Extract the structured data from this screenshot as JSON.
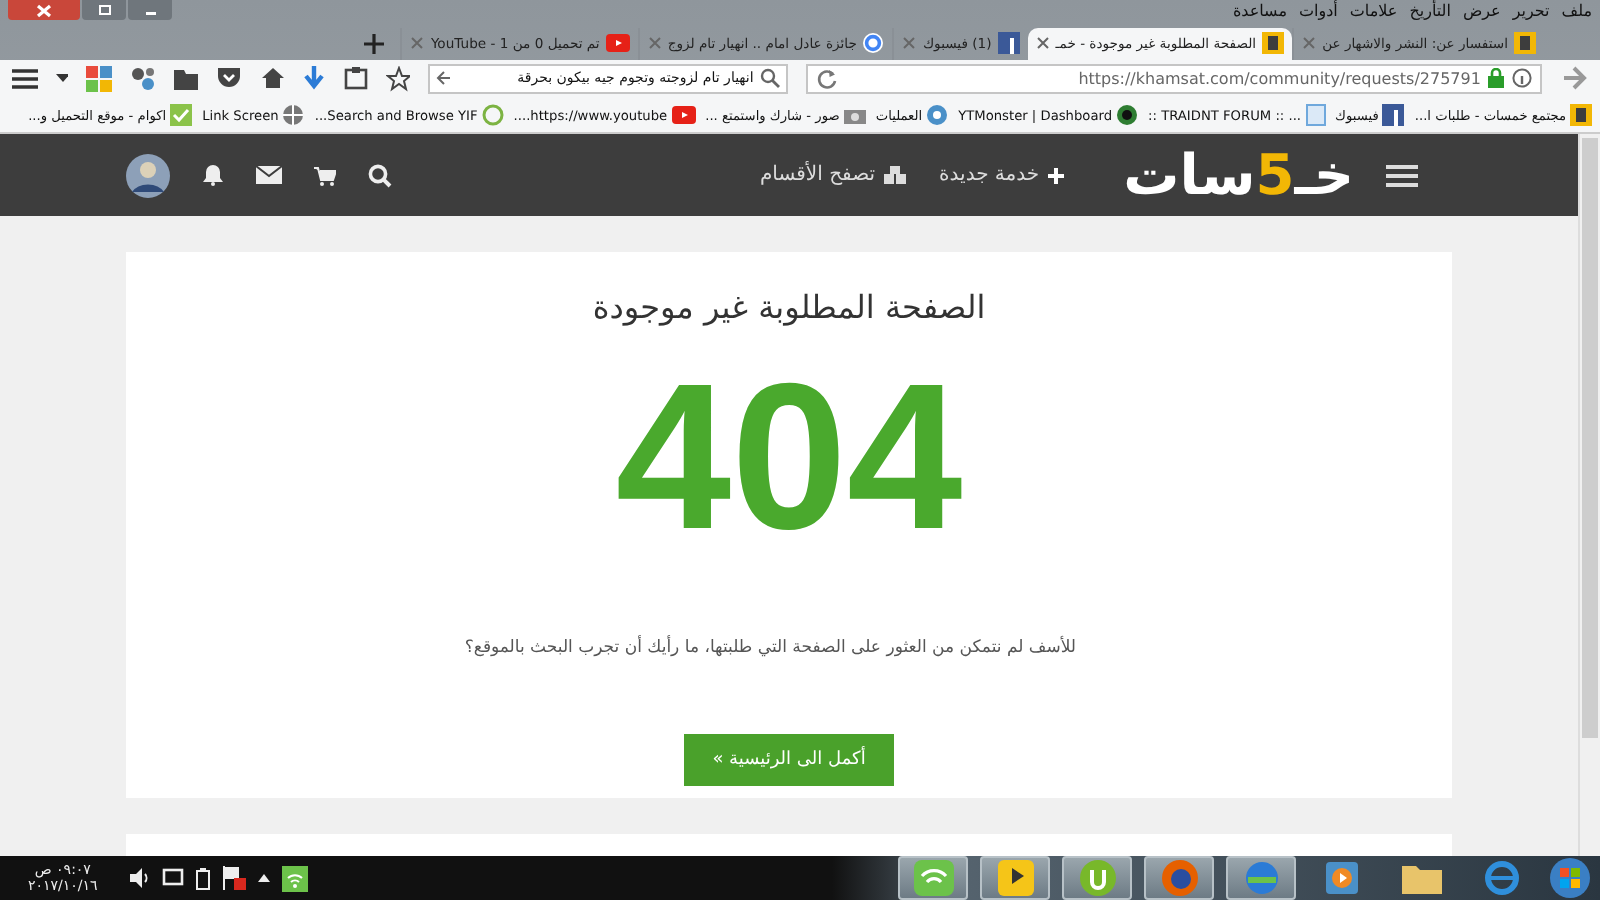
{
  "menu_bar": [
    "ملف",
    "تحرير",
    "عرض",
    "التأريخ",
    "علامات",
    "أدوات",
    "مساعدة"
  ],
  "tabs": [
    {
      "title": "استفسار عن: النشر والاشهار عن",
      "kind": "khamsat",
      "selected": false
    },
    {
      "title": "الصفحة المطلوبة غير موجودة - خمـ",
      "kind": "khamsat",
      "selected": true
    },
    {
      "title": "(1) فيسبوك",
      "kind": "facebook",
      "selected": false
    },
    {
      "title": "جائزة عادل امام .. انهيار تام لزوج",
      "kind": "google",
      "selected": false
    },
    {
      "title": "تم تحميل 0 من 1 - YouTube",
      "kind": "youtube",
      "selected": false
    }
  ],
  "toolbar": {
    "url": "https://khamsat.com/community/requests/275791",
    "search_value": "انهيار تام لزوجته وتجوم جيه بيكون بحرقة"
  },
  "bookmarks": [
    {
      "title": "مجتمع خمسات - طلبات ا...",
      "kind": "khamsat"
    },
    {
      "title": "فيسبوك",
      "kind": "facebook"
    },
    {
      "title": "... :: TRAIDNT FORUM ::",
      "kind": "page"
    },
    {
      "title": "YTMonster | Dashboard",
      "kind": "circle"
    },
    {
      "title": "العمليات",
      "kind": "gear"
    },
    {
      "title": "صور - شارك واستمتع ...",
      "kind": "camera"
    },
    {
      "title": "https://www.youtube....",
      "kind": "youtube"
    },
    {
      "title": "Search and Browse YIF...",
      "kind": "leaf"
    },
    {
      "title": "Link Screen",
      "kind": "globe"
    },
    {
      "title": "اكوام - موقع التحميل و...",
      "kind": "check"
    }
  ],
  "site_header": {
    "logo_start": "خـ",
    "logo_mark": "5",
    "logo_end": "سات",
    "new_service": "خدمة جديدة",
    "browse": "تصفح الأقسام"
  },
  "error_card": {
    "title": "الصفحة المطلوبة غير موجودة",
    "code": "404",
    "message": "للأسف لم نتمكن من العثور على الصفحة التي طلبتها، ما رأيك أن تجرب البحث بالموقع؟",
    "button": "أكمل الى الرئيسية »"
  },
  "taskbar": {
    "time": "٠٩:٠٧ ص",
    "date": "٢٠١٧/١٠/١٦",
    "apps": [
      {
        "kind": "wifi",
        "running": true
      },
      {
        "kind": "player",
        "running": true
      },
      {
        "kind": "torrent",
        "running": true
      },
      {
        "kind": "firefox",
        "running": true
      },
      {
        "kind": "download",
        "running": true
      },
      {
        "kind": "media",
        "running": false
      },
      {
        "kind": "folder",
        "running": false
      },
      {
        "kind": "ie",
        "running": false
      }
    ]
  }
}
